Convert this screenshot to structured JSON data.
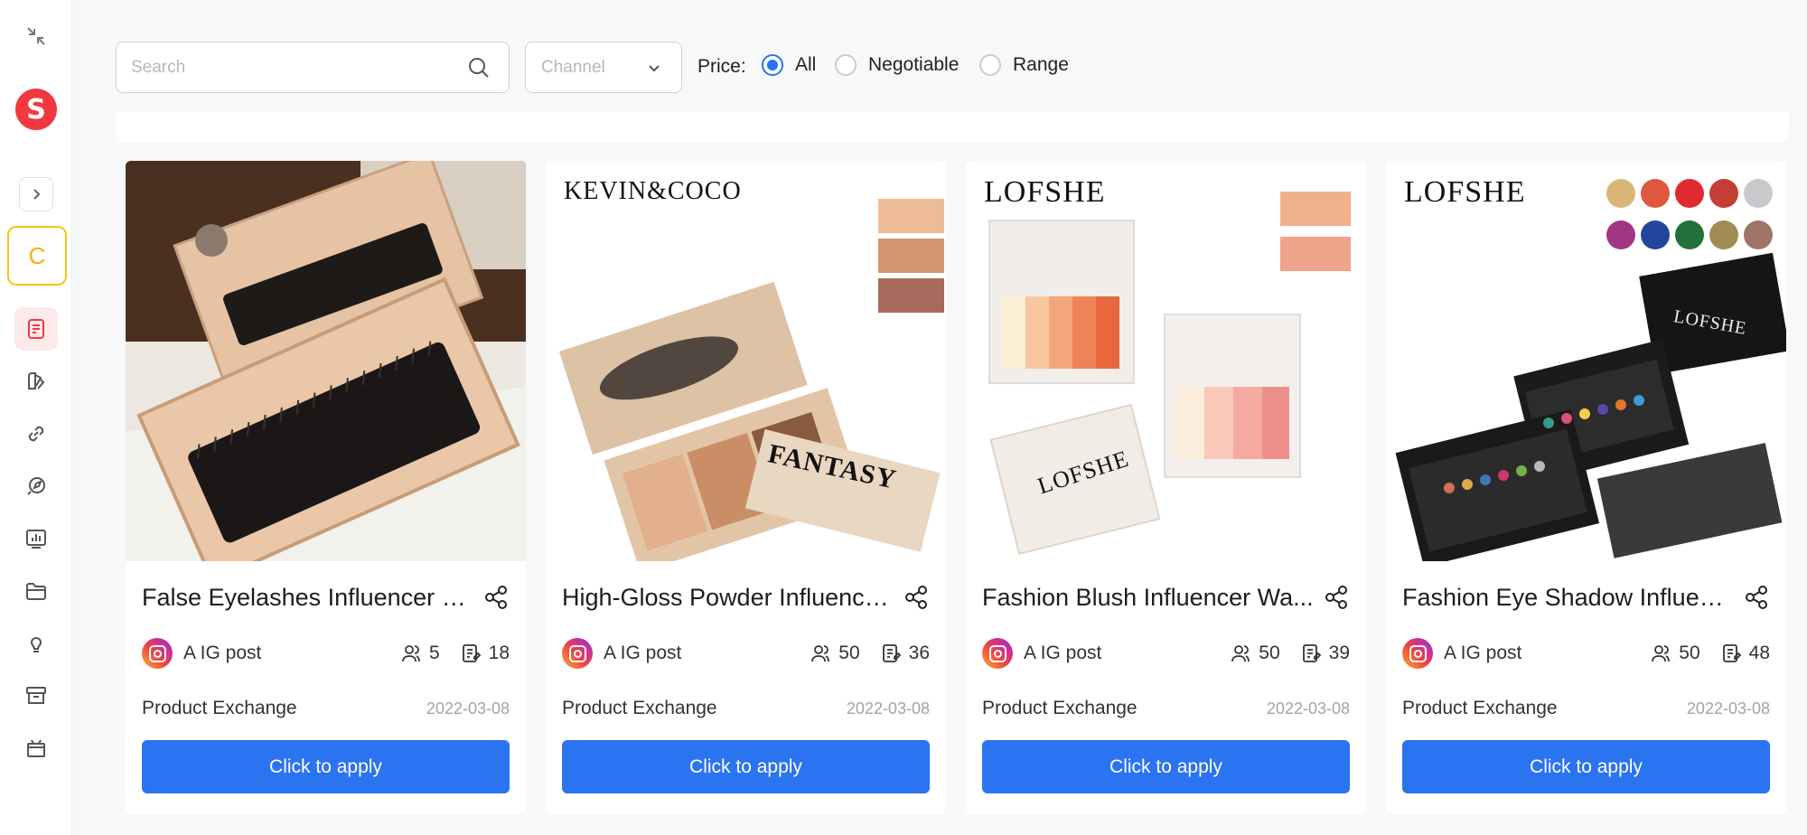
{
  "sidebar": {
    "avatar_letter": "C",
    "icons": [
      "collapse-icon",
      "brand-logo",
      "expand-icon",
      "avatar",
      "task-icon",
      "brush-icon",
      "link-icon",
      "compass-icon",
      "chart-icon",
      "folder-icon",
      "bulb-icon",
      "box-icon",
      "gift-icon"
    ]
  },
  "filters": {
    "search_placeholder": "Search",
    "channel_placeholder": "Channel",
    "price_label": "Price:",
    "price_options": [
      "All",
      "Negotiable",
      "Range"
    ],
    "price_selected": "All"
  },
  "cards": [
    {
      "title": "False Eyelashes Influencer W...",
      "channel": "A IG post",
      "influencers": "5",
      "posts": "18",
      "type": "Product Exchange",
      "date": "2022-03-08",
      "button": "Click to apply"
    },
    {
      "title": "High-Gloss Powder Influence...",
      "channel": "A IG post",
      "influencers": "50",
      "posts": "36",
      "type": "Product Exchange",
      "date": "2022-03-08",
      "button": "Click to apply",
      "brand": "KEVIN&COCO",
      "box_text": "FANTASY"
    },
    {
      "title": "Fashion Blush Influencer Wa...",
      "channel": "A IG post",
      "influencers": "50",
      "posts": "39",
      "type": "Product Exchange",
      "date": "2022-03-08",
      "button": "Click to apply",
      "brand": "LOFSHE",
      "box_text": "LOFSHE"
    },
    {
      "title": "Fashion Eye Shadow Influenc...",
      "channel": "A IG post",
      "influencers": "50",
      "posts": "48",
      "type": "Product Exchange",
      "date": "2022-03-08",
      "button": "Click to apply",
      "brand": "LOFSHE",
      "box_text": "LOFSHE"
    }
  ],
  "colors": {
    "accent": "#2a73f1",
    "brand": "#f0393f",
    "avatar_border": "#f5c518"
  }
}
